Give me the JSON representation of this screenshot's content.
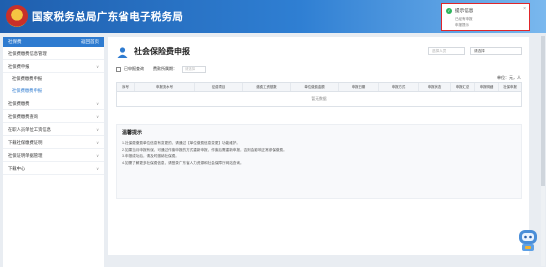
{
  "header": {
    "title": "国家税务总局广东省电子税务局"
  },
  "toast": {
    "title": "提示信息",
    "line1": "已经有申报",
    "line2": "申报提示",
    "close": "×"
  },
  "sidebar": {
    "head_left": "社保费",
    "head_right": "返回首页",
    "items": [
      {
        "label": "社保费缴费信息管理",
        "caret": ""
      },
      {
        "label": "社保费申报",
        "caret": "∨"
      },
      {
        "label": "社保费缴费申报",
        "sub": true
      },
      {
        "label": "社保费缴费申报",
        "sub": true,
        "active": true
      },
      {
        "label": "社保费缴费",
        "caret": "∨"
      },
      {
        "label": "社保费缴费查询",
        "caret": "∨"
      },
      {
        "label": "在职人员单位工资信息",
        "caret": "∨"
      },
      {
        "label": "下载社保缴费证明",
        "caret": "∨"
      },
      {
        "label": "社保证明单据管理",
        "caret": "∨"
      },
      {
        "label": "下载中心",
        "caret": "∨"
      }
    ]
  },
  "main": {
    "title": "社会保险费申报",
    "search_placeholder": "选择人员",
    "select_value": "请选择",
    "filter": {
      "checkbox_label": "已申报查询",
      "period_label": "费款所属期：",
      "period_placeholder": "请选择"
    },
    "unit_label": "单位：元，人",
    "table": {
      "headers": [
        "序号",
        "申报流水号",
        "征费项目",
        "缴费工资基数",
        "单位缴费金额",
        "申报日期",
        "申报方式",
        "申报状态",
        "申报汇总",
        "申报明细",
        "社保申报"
      ],
      "empty_text": "暂无数据"
    },
    "notice": {
      "title": "温馨提示",
      "lines": [
        "1.社保费缴费单位信息有变更的，请通过【单位缴费信息变更】功能维护。",
        "2.如果当月申报有误，可通过作废申报的方式重新申报，作废后需重新申报，否则会影响正常参保缴费。",
        "3.申报成功后，请及时缴纳社保费。",
        "4.如需了解更多社保费信息，请登录广东省人力资源和社会保障厅网站查询。"
      ]
    }
  },
  "colors": {
    "header": "#1f5fae",
    "accent": "#2e7bd0",
    "toast_border": "#e0262a"
  },
  "icons": {
    "emblem": "national-emblem",
    "page": "people-icon",
    "assistant": "robot-assistant-icon",
    "toast": "check-circle-icon"
  }
}
